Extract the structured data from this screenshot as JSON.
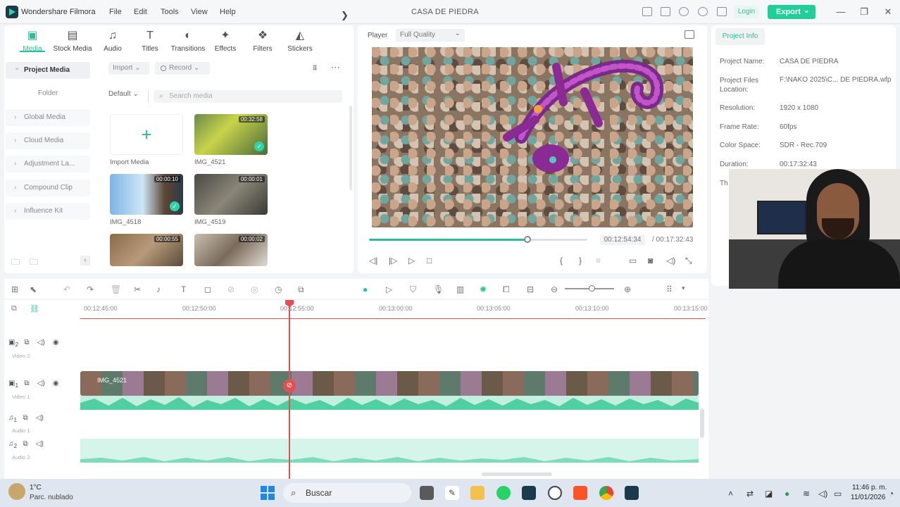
{
  "app": {
    "name": "Wondershare Filmora",
    "menu": [
      "File",
      "Edit",
      "Tools",
      "View",
      "Help"
    ],
    "window_title": "CASA DE PIEDRA",
    "login_label": "Login",
    "export_label": "Export",
    "window_controls": [
      "—",
      "❐",
      "✕"
    ]
  },
  "media_tabs": [
    {
      "label": "Media",
      "icon": "media-icon",
      "glyph": "▣"
    },
    {
      "label": "Stock Media",
      "icon": "stock-media-icon",
      "glyph": "▤"
    },
    {
      "label": "Audio",
      "icon": "music-note-icon",
      "glyph": "♫"
    },
    {
      "label": "Titles",
      "icon": "titles-icon",
      "glyph": "T"
    },
    {
      "label": "Transitions",
      "icon": "transitions-icon",
      "glyph": "◐"
    },
    {
      "label": "Effects",
      "icon": "effects-icon",
      "glyph": "✦"
    },
    {
      "label": "Filters",
      "icon": "filters-icon",
      "glyph": "❖"
    },
    {
      "label": "Stickers",
      "icon": "stickers-icon",
      "glyph": "◭"
    }
  ],
  "media_sidebar": {
    "project_media": "Project Media",
    "folder": "Folder",
    "items": [
      "Global Media",
      "Cloud Media",
      "Adjustment La...",
      "Compound Clip",
      "Influence Kit"
    ]
  },
  "media_toolbar": {
    "import": "Import",
    "record": "Record",
    "sort": "Default",
    "search_placeholder": "Search media"
  },
  "media_items": {
    "import_label": "Import Media",
    "clips": [
      {
        "name": "IMG_4521",
        "duration": "00:32:58"
      },
      {
        "name": "IMG_4518",
        "duration": "00:00:10"
      },
      {
        "name": "IMG_4519",
        "duration": "00:00:01"
      },
      {
        "name": "",
        "duration": "00:00:55"
      },
      {
        "name": "",
        "duration": "00:00:02"
      }
    ]
  },
  "player": {
    "label": "Player",
    "quality": "Full Quality",
    "current_time": "00:12:54:34",
    "total_time": "/ 00:17:32:43",
    "progress": 0.735
  },
  "project_info": {
    "tab": "Project Info",
    "rows": [
      {
        "key": "Project Name:",
        "value": "CASA DE PIEDRA"
      },
      {
        "key": "Project Files Location:",
        "value": "F:\\NAKO 2025\\C... DE PIEDRA.wfp"
      },
      {
        "key": "Resolution:",
        "value": "1920 x 1080"
      },
      {
        "key": "Frame Rate:",
        "value": "60fps"
      },
      {
        "key": "Color Space:",
        "value": "SDR - Rec.709"
      },
      {
        "key": "Duration:",
        "value": "00:17:32:43"
      },
      {
        "key": "Th",
        "value": ""
      }
    ]
  },
  "timeline": {
    "ruler": [
      "00:12:45:00",
      "00:12:50:00",
      "00:12:55:00",
      "00:13:00:00",
      "00:13:05:00",
      "00:13:10:00",
      "00:13:15:00"
    ],
    "tracks": [
      {
        "label": "Video 2"
      },
      {
        "label": "Video 1",
        "clip": "IMG_4521"
      },
      {
        "label": "Audio 1"
      },
      {
        "label": "Audio 2"
      }
    ]
  },
  "taskbar": {
    "temperature": "1°C",
    "weather": "Parc. nublado",
    "search": "Buscar",
    "time": "11:46 p. m.",
    "date": "11/01/2026"
  },
  "colors": {
    "accent": "#2bbf96",
    "export": "#1fcf9a",
    "playhead": "#e25050"
  }
}
